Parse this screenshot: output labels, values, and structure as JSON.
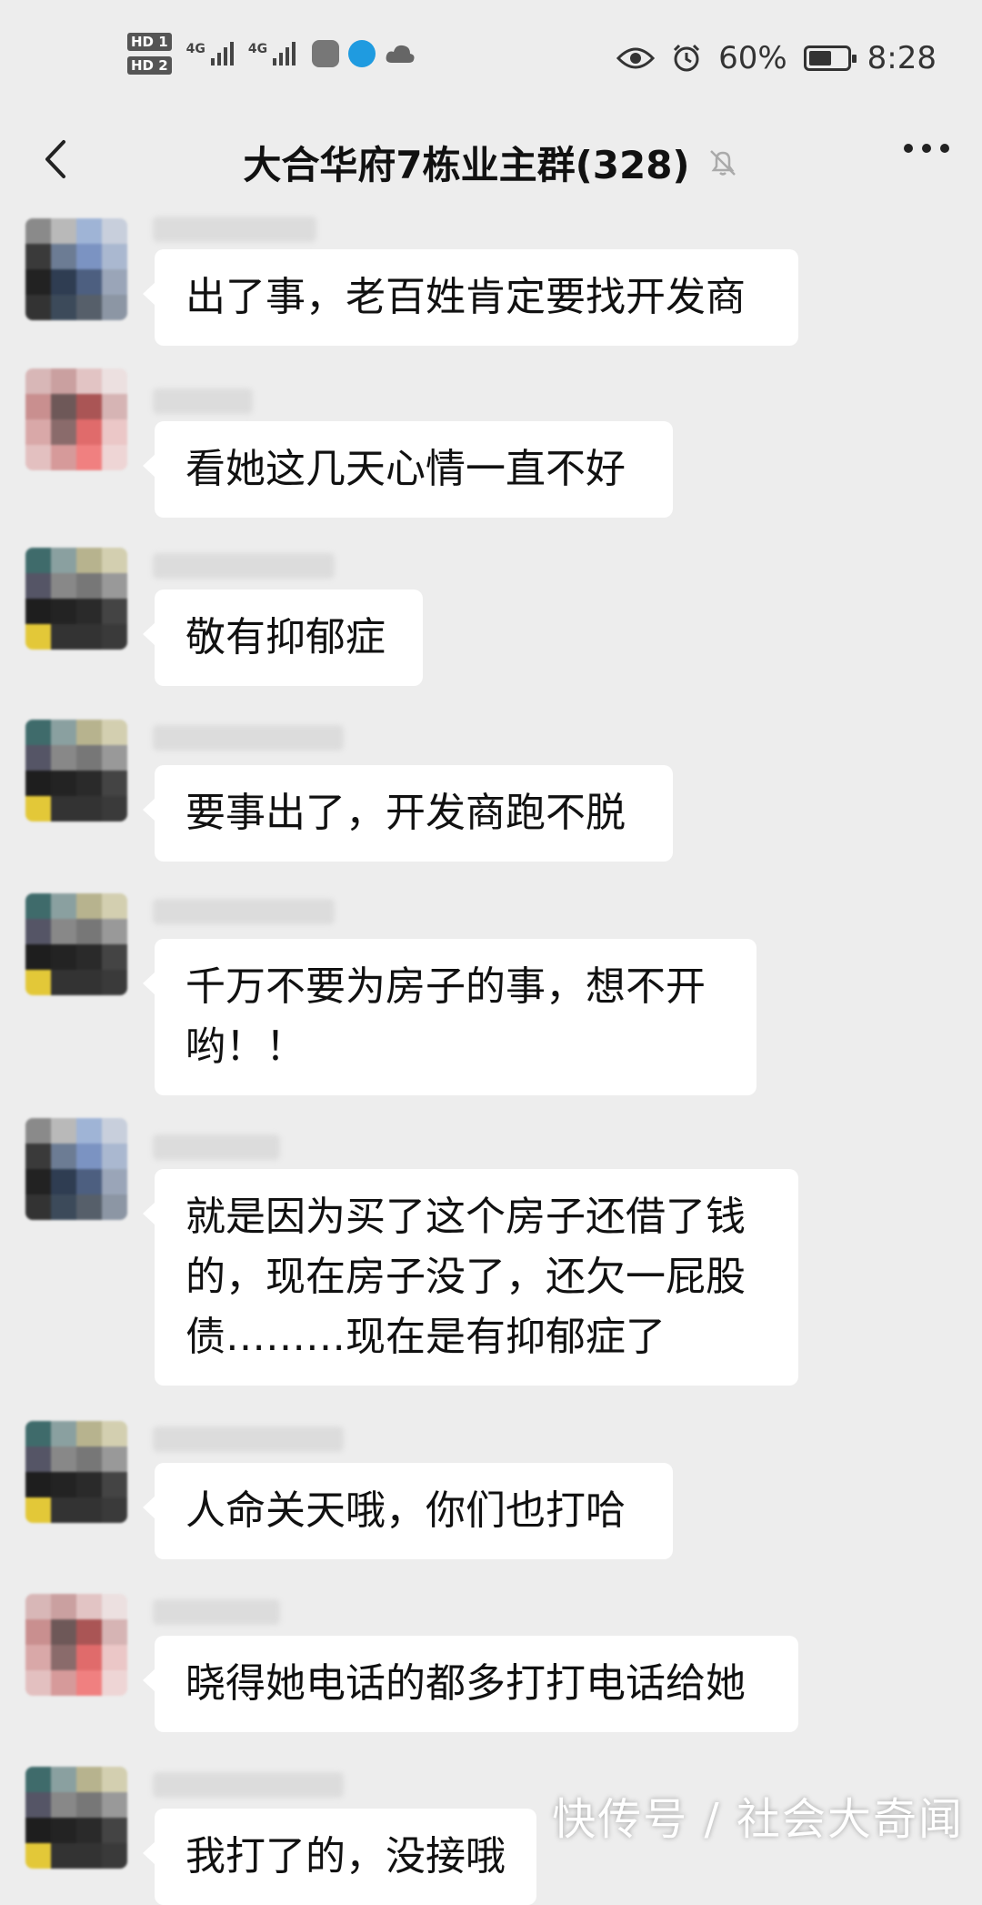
{
  "status_bar": {
    "hd1": "HD 1",
    "hd2": "HD 2",
    "net1": "4G",
    "net2": "4G",
    "battery_percent_text": "60%",
    "battery_level": 0.6,
    "time": "8:28",
    "icons": [
      "signal-icon",
      "signal-icon",
      "shield-app-icon",
      "globe-app-icon",
      "cloud-icon",
      "eye-icon",
      "alarm-icon",
      "battery-icon"
    ]
  },
  "header": {
    "title": "大合华府7栋业主群(328)",
    "back_icon": "chevron-left-icon",
    "mute_icon": "bell-muted-icon",
    "more_icon": "more-dots-icon"
  },
  "messages": [
    {
      "text": "出了事，老百姓肯定要找开发商"
    },
    {
      "text": "看她这几天心情一直不好"
    },
    {
      "text": "敬有抑郁症"
    },
    {
      "text": "要事出了，开发商跑不脱"
    },
    {
      "text": "千万不要为房子的事，想不开\n哟！！"
    },
    {
      "text": "就是因为买了这个房子还借了钱\n的，现在房子没了，还欠一屁股\n债………现在是有抑郁症了"
    },
    {
      "text": "人命关天哦，你们也打哈"
    },
    {
      "text": "晓得她电话的都多打打电话给她"
    },
    {
      "text": "我打了的，没接哦"
    }
  ],
  "watermark": "快传号 / 社会大奇闻",
  "colors": {
    "background": "#ededed",
    "bubble": "#ffffff",
    "text": "#111111"
  }
}
